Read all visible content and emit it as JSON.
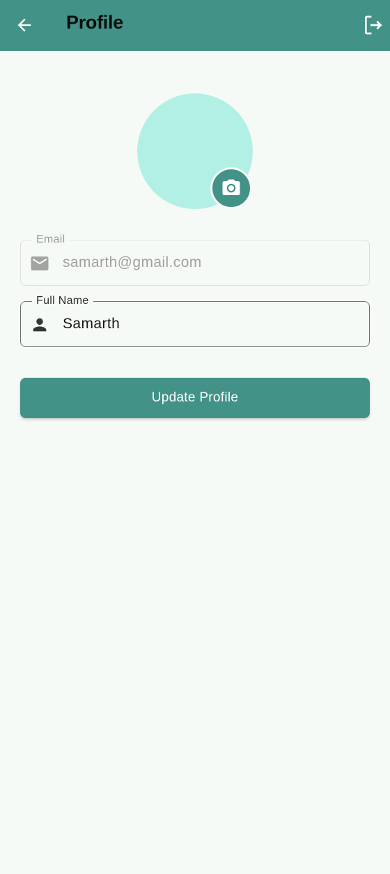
{
  "app_bar": {
    "title": "Profile",
    "back_icon": "arrow-left-icon",
    "logout_icon": "logout-icon",
    "background_color": "#439287"
  },
  "avatar": {
    "background_color": "#b2f0e5",
    "camera_icon": "camera-icon"
  },
  "form": {
    "email": {
      "label": "Email",
      "value": "samarth@gmail.com",
      "icon": "mail-icon",
      "enabled": false
    },
    "full_name": {
      "label": "Full Name",
      "value": "Samarth",
      "icon": "person-icon",
      "enabled": true
    }
  },
  "update_button": {
    "label": "Update Profile",
    "color": "#439287"
  }
}
